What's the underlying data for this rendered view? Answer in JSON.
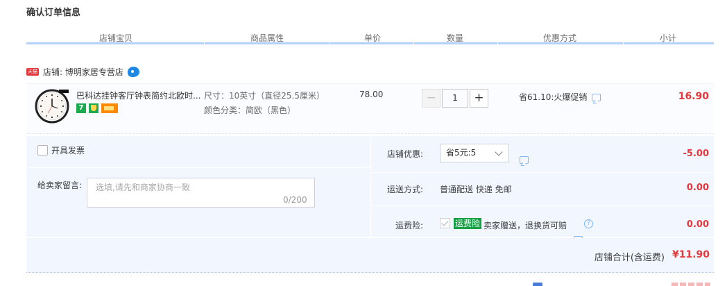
{
  "page_title": "确认订单信息",
  "columns": [
    "店铺宝贝",
    "商品属性",
    "单价",
    "数量",
    "优惠方式",
    "小计"
  ],
  "shop": {
    "badge": "天猫",
    "label": "店铺: 博明家居专营店"
  },
  "item": {
    "title": "巴科达挂钟客厅钟表简约北欧时...",
    "attr_size": "尺寸：10英寸（直径25.5厘米）",
    "attr_color": "颜色分类：简欧（黑色）",
    "price": "78.00",
    "quantity": "1",
    "qty_minus": "−",
    "qty_plus": "+",
    "badge_7": "7",
    "promo": "省61.10:火爆促销",
    "subtotal": "16.90"
  },
  "invoice_label": "开具发票",
  "memo": {
    "label": "给卖家留言:",
    "placeholder": "选填,请先和商家协商一致",
    "count": "0/200"
  },
  "shop_discount": {
    "label": "店铺优惠:",
    "selected": "省5元:5",
    "value": "-5.00"
  },
  "shipping": {
    "label": "运送方式:",
    "method": "普通配送 快递 免邮",
    "value": "0.00"
  },
  "insurance": {
    "label": "运费险:",
    "badge": "运费险",
    "text": "卖家赠送，退换货可赔",
    "help": "?",
    "value": "0.00"
  },
  "shop_total": {
    "label": "店铺合计(含运费)",
    "value": "¥11.90"
  },
  "colors": {
    "accent_red": "#e4393c",
    "header_line": "#b2d1ff",
    "panel_bg": "#f2f7ff",
    "insurance_green": "#17a045"
  }
}
